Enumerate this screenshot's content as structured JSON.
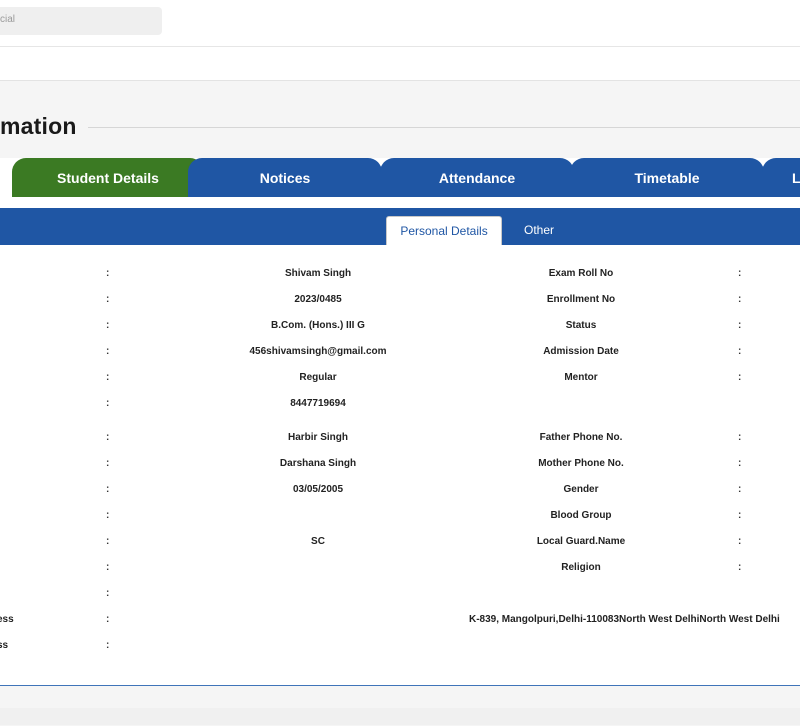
{
  "search": {
    "placeholder": "cial"
  },
  "section_title": "mation",
  "tabs": [
    {
      "label": "Student Details",
      "active": true
    },
    {
      "label": "Notices",
      "active": false
    },
    {
      "label": "Attendance",
      "active": false
    },
    {
      "label": "Timetable",
      "active": false
    },
    {
      "label": "L",
      "active": false
    }
  ],
  "subtabs": [
    {
      "label": "Personal Details",
      "active": true
    },
    {
      "label": "Other",
      "active": false
    }
  ],
  "rows": [
    {
      "label1": "",
      "value1": "Shivam Singh",
      "label2": "Exam Roll No",
      "colon2": true
    },
    {
      "label1": "",
      "value1": "2023/0485",
      "label2": "Enrollment No",
      "colon2": true
    },
    {
      "label1": "",
      "value1": "B.Com. (Hons.) III G",
      "label2": "Status",
      "colon2": true
    },
    {
      "label1": "",
      "value1": "456shivamsingh@gmail.com",
      "label2": "Admission Date",
      "colon2": true
    },
    {
      "label1": "",
      "value1": "Regular",
      "label2": "Mentor",
      "colon2": true
    },
    {
      "label1": "",
      "value1": "8447719694",
      "label2": "",
      "colon2": false
    },
    {
      "label1": "",
      "value1": "Harbir Singh",
      "label2": "Father Phone No.",
      "colon2": true
    },
    {
      "label1": "",
      "value1": "Darshana Singh",
      "label2": "Mother Phone No.",
      "colon2": true
    },
    {
      "label1": "",
      "value1": "03/05/2005",
      "label2": "Gender",
      "colon2": true
    },
    {
      "label1": "",
      "value1": "",
      "label2": "Blood Group",
      "colon2": true
    },
    {
      "label1": "",
      "value1": "SC",
      "label2": "Local Guard.Name",
      "colon2": true
    },
    {
      "label1": "",
      "value1": "",
      "label2": "Religion",
      "colon2": true
    },
    {
      "label1": "",
      "value1": "",
      "label2": "",
      "colon2": false
    },
    {
      "label1": "ess",
      "value1": "K-839, Mangolpuri,Delhi-110083North West DelhiNorth West Delhi",
      "label2": "",
      "colon2": false
    },
    {
      "label1": "ss",
      "value1": "",
      "label2": "",
      "colon2": false
    }
  ],
  "colors": {
    "active_tab": "#3b7a23",
    "tab": "#1f56a4"
  }
}
